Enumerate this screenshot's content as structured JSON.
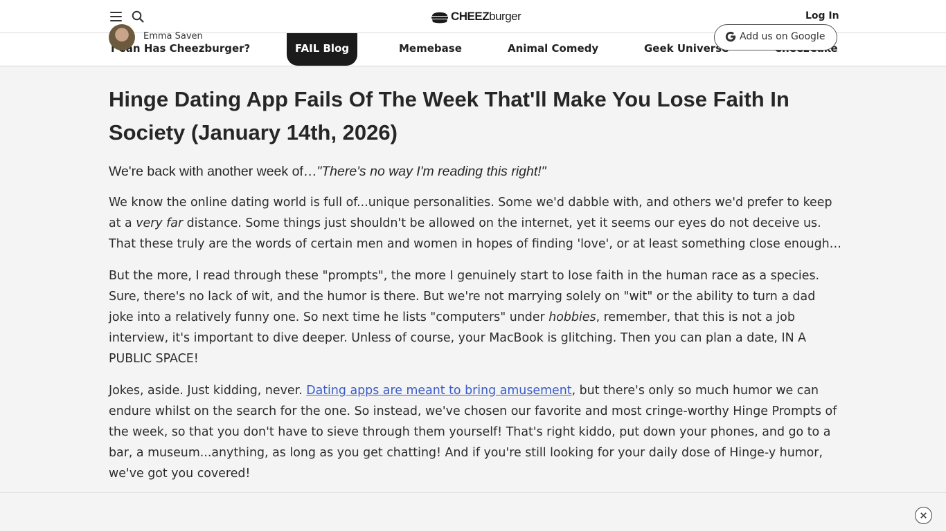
{
  "header": {
    "logo_text_bold": "CHEEZ",
    "logo_text_light": "burger",
    "login_label": "Log In"
  },
  "nav": {
    "items": [
      {
        "label": "I Can Has Cheezburger?"
      },
      {
        "label": "FAIL Blog"
      },
      {
        "label": "Memebase"
      },
      {
        "label": "Animal Comedy"
      },
      {
        "label": "Geek Universe"
      },
      {
        "label": "CheezCake"
      }
    ],
    "active_index": 1
  },
  "article": {
    "title": "Hinge Dating App Fails Of The Week That'll Make You Lose Faith In Society (January 14th, 2026)",
    "subhead_plain": "We're back with another week of…",
    "subhead_italic": "\"There's no way I'm reading this right!\"",
    "p1_a": "We know the online dating world is full of...unique personalities. Some we'd dabble with, and others we'd prefer to keep at a ",
    "p1_em": "very far",
    "p1_b": " distance. Some things just shouldn't be allowed on the internet, yet it seems our eyes do not deceive us. That these truly are the words of certain men and women in hopes of finding 'love', or at least something close enough…",
    "p2_a": "But the more, I read through these \"prompts\", the more I genuinely start to lose faith in the human race as a species. Sure, there's no lack of wit, and the humor is there. But we're not marrying solely on \"wit\" or the ability to turn a dad joke into a relatively funny one. So next time he lists \"computers\" under ",
    "p2_em": "hobbies",
    "p2_b": ", remember, that this is not a job interview, it's important to dive deeper. Unless of course, your MacBook is glitching. Then you can plan a date, IN A PUBLIC SPACE!",
    "p3_a": "Jokes, aside. Just kidding, never. ",
    "p3_link": "Dating apps are meant to bring amusement",
    "p3_b": ", but there's only so much humor we can endure whilst on the search for the one. So instead, we've chosen our favorite and most cringe-worthy Hinge Prompts of the week, so that you don't have to sieve through them yourself! That's right kiddo, put down your phones, and go to a bar, a museum...anything, as long as you get chatting! And if you're still looking for your daily dose of Hinge-y humor, we've got you covered!"
  },
  "author": {
    "name": "Emma Saven",
    "google_button": "Add us on Google"
  },
  "colors": {
    "link": "#3a5bc7",
    "nav_active_bg": "#1b1b1b",
    "page_bg": "#f4f4f4"
  },
  "icons": [
    "hamburger-menu-icon",
    "search-icon",
    "cheezburger-logo-icon",
    "google-g-icon",
    "close-icon"
  ]
}
